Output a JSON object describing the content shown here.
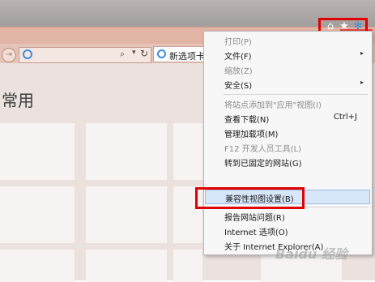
{
  "window": {
    "minimize_glyph": "—",
    "maximize_glyph": "☐",
    "close_glyph": "✕"
  },
  "navbar": {
    "back_glyph": "→",
    "address_value": "",
    "search_glyph": "⌕",
    "dropdown_glyph": "▾",
    "refresh_glyph": "↻",
    "tab_label": "新选项卡",
    "tab_close_glyph": "×"
  },
  "toolbar": {
    "home_icon": "home-icon",
    "favorites_icon": "star-icon",
    "tools_icon": "gear-icon",
    "home_glyph": "⌂",
    "star_glyph": "★",
    "gear_glyph": "✻"
  },
  "content": {
    "heading": "常用"
  },
  "menu": {
    "items": [
      {
        "label": "打印(P)",
        "disabled": true,
        "shortcut": "",
        "submenu": false
      },
      {
        "label": "文件(F)",
        "disabled": false,
        "shortcut": "",
        "submenu": true
      },
      {
        "label": "缩放(Z)",
        "disabled": true,
        "shortcut": "",
        "submenu": false
      },
      {
        "label": "安全(S)",
        "disabled": false,
        "shortcut": "",
        "submenu": true
      },
      {
        "label": "将站点添加到\"应用\"视图(I)",
        "disabled": true,
        "shortcut": "",
        "submenu": false
      },
      {
        "label": "查看下载(N)",
        "disabled": false,
        "shortcut": "Ctrl+J",
        "submenu": false
      },
      {
        "label": "管理加载项(M)",
        "disabled": false,
        "shortcut": "",
        "submenu": false
      },
      {
        "label": "F12 开发人员工具(L)",
        "disabled": true,
        "shortcut": "",
        "submenu": false
      },
      {
        "label": "转到已固定的网站(G)",
        "disabled": false,
        "shortcut": "",
        "submenu": false
      },
      {
        "label": "兼容性视图设置(B)",
        "disabled": false,
        "shortcut": "",
        "submenu": false,
        "highlighted": true
      },
      {
        "label": "报告网站问题(R)",
        "disabled": false,
        "shortcut": "",
        "submenu": false
      },
      {
        "label": "Internet 选项(O)",
        "disabled": false,
        "shortcut": "",
        "submenu": false
      },
      {
        "label": "关于 Internet Explorer(A)",
        "disabled": false,
        "shortcut": "",
        "submenu": false
      }
    ],
    "submenu_arrow": "▸"
  },
  "watermark": "Baidu 经验"
}
